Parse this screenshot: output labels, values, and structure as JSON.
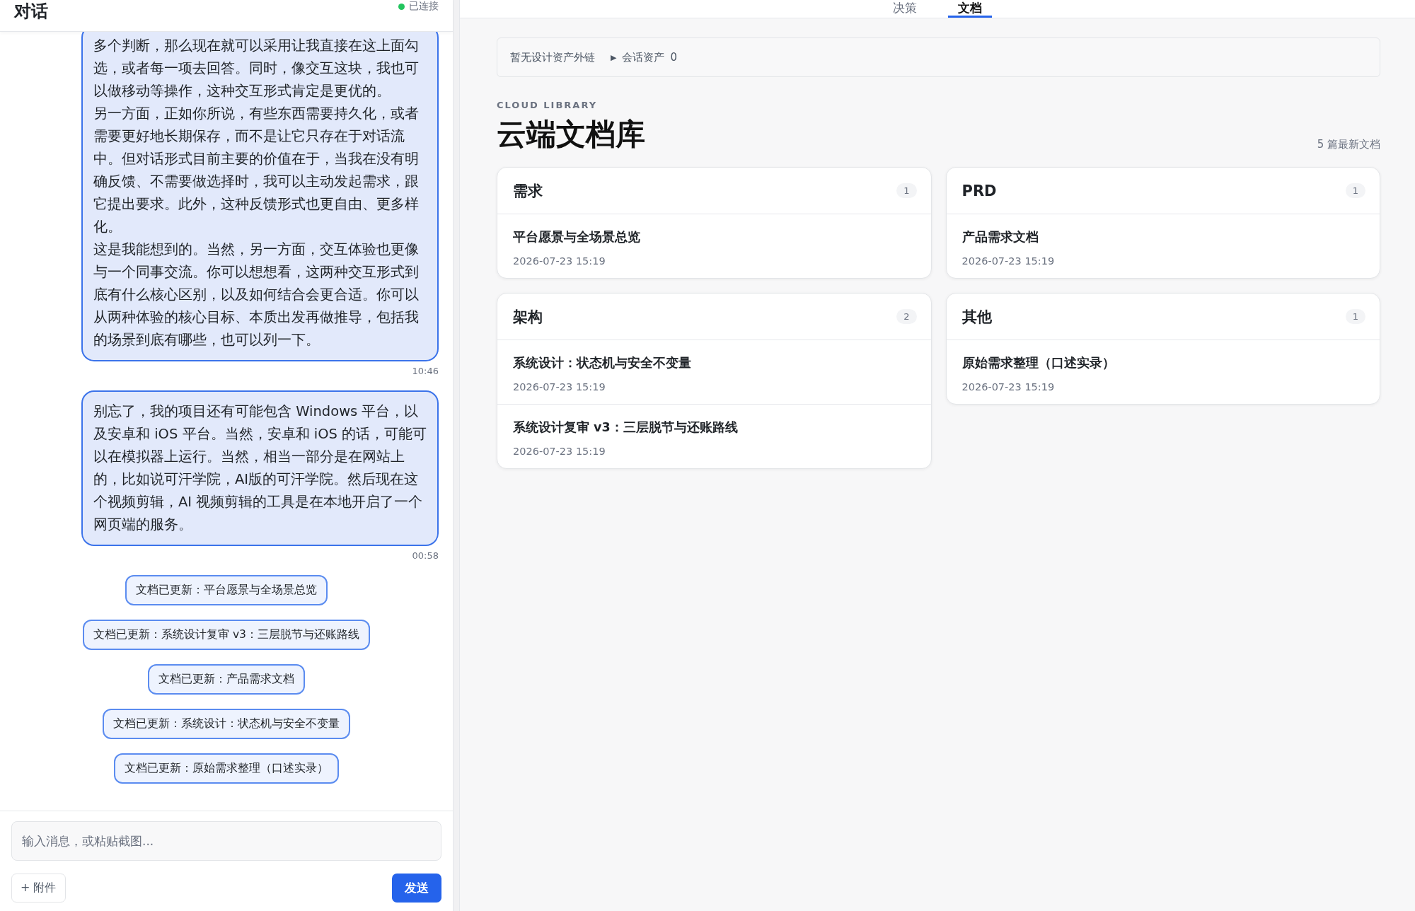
{
  "chat": {
    "title": "对话",
    "status": "已连接",
    "messages": [
      {
        "kind": "user",
        "paragraphs": [
          "多个判断，那么现在就可以采用让我直接在这上面勾选，或者每一项去回答。同时，像交互这块，我也可以做移动等操作，这种交互形式肯定是更优的。",
          "另一方面，正如你所说，有些东西需要持久化，或者需要更好地长期保存，而不是让它只存在于对话流中。但对话形式目前主要的价值在于，当我在没有明确反馈、不需要做选择时，我可以主动发起需求，跟它提出要求。此外，这种反馈形式也更自由、更多样化。",
          "这是我能想到的。当然，另一方面，交互体验也更像与一个同事交流。你可以想想看，这两种交互形式到底有什么核心区别，以及如何结合会更合适。你可以从两种体验的核心目标、本质出发再做推导，包括我的场景到底有哪些，也可以列一下。"
        ],
        "time": "10:46"
      },
      {
        "kind": "user",
        "paragraphs": [
          "别忘了，我的项目还有可能包含 Windows 平台，以及安卓和 iOS 平台。当然，安卓和 iOS 的话，可能可以在模拟器上运行。当然，相当一部分是在网站上的，比如说可汗学院，AI版的可汗学院。然后现在这个视频剪辑，AI 视频剪辑的工具是在本地开启了一个网页端的服务。"
        ],
        "time": "00:58"
      },
      {
        "kind": "event",
        "text": "文档已更新：平台愿景与全场景总览"
      },
      {
        "kind": "event",
        "text": "文档已更新：系统设计复审 v3：三层脱节与还账路线"
      },
      {
        "kind": "event",
        "text": "文档已更新：产品需求文档"
      },
      {
        "kind": "event",
        "text": "文档已更新：系统设计：状态机与安全不变量"
      },
      {
        "kind": "event",
        "text": "文档已更新：原始需求整理（口述实录）"
      }
    ],
    "input": {
      "placeholder": "输入消息，或粘贴截图..."
    },
    "attach_button": "+ 附件",
    "send_button": "发送"
  },
  "tabs": [
    {
      "label": "决策",
      "selected": false
    },
    {
      "label": "文档",
      "selected": true
    }
  ],
  "assets_bar": {
    "links": "暂无设计资产外链",
    "toggle": "▶",
    "label": "会话资产",
    "count": "0"
  },
  "library": {
    "eyebrow": "CLOUD LIBRARY",
    "title": "云端文档库",
    "summary": "5 篇最新文档",
    "groups": [
      {
        "name": "需求",
        "count": "1",
        "docs": [
          {
            "title": "平台愿景与全场景总览",
            "date": "2026-07-23 15:19"
          }
        ]
      },
      {
        "name": "PRD",
        "count": "1",
        "docs": [
          {
            "title": "产品需求文档",
            "date": "2026-07-23 15:19"
          }
        ]
      },
      {
        "name": "架构",
        "count": "2",
        "docs": [
          {
            "title": "系统设计：状态机与安全不变量",
            "date": "2026-07-23 15:19"
          },
          {
            "title": "系统设计复审 v3：三层脱节与还账路线",
            "date": "2026-07-23 15:19"
          }
        ]
      },
      {
        "name": "其他",
        "count": "1",
        "docs": [
          {
            "title": "原始需求整理（口述实录）",
            "date": "2026-07-23 15:19"
          }
        ]
      }
    ]
  }
}
